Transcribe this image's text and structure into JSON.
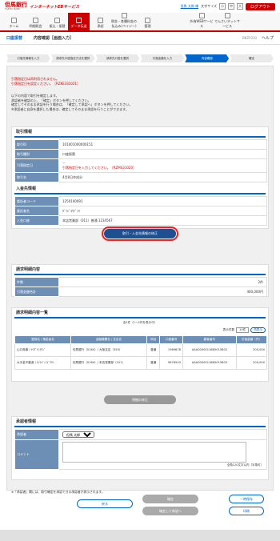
{
  "header": {
    "logo": "但馬銀行",
    "logo_sub": "TAJIMA BANK",
    "service": "インターネットEBサービス",
    "user_line": "但馬 太郎 様",
    "font_label": "文字サイズ",
    "font_small": "小",
    "font_medium": "中",
    "font_large": "大",
    "logout": "ログアウト"
  },
  "nav": [
    {
      "label": "ホーム"
    },
    {
      "label": "明細照会"
    },
    {
      "label": "振込・振替"
    },
    {
      "label": "データ伝送"
    },
    {
      "label": "承認"
    },
    {
      "label": "税金・各種料金の払込み(ペイジー)"
    },
    {
      "label": "管理"
    },
    {
      "label": "外為WEBサービス"
    },
    {
      "label": "でんさいネットサービス"
    }
  ],
  "subheader": {
    "category": "口座振替",
    "title": "内容確認［画面入力］",
    "code": "BKZF010",
    "help": "ヘルプ"
  },
  "steps": [
    "引落先情報を入力",
    "請求先口座指定方法を選択",
    "請求先口座を選択",
    "引落金額を入力",
    "内容確認",
    "確定"
  ],
  "errors": [
    "引落指定日は再利用されません。",
    "引落指定日を設定ください。［RZKE331021］"
  ],
  "intro": [
    "以下の内容で取引を確定します。",
    "承認者を確認の上、「確定」ボタンを押してください。",
    "確定してそのまま承認を行う場合は、「確定して承認へ」ボタンを押してください。",
    "※承認者に自身を選択した場合は、確定してそのまま承認を行うことができます。"
  ],
  "torihiki": {
    "section": "取引情報",
    "rows": [
      {
        "label": "取引ID",
        "value": "101001000000151"
      },
      {
        "label": "取引種別",
        "value": "口座振替"
      },
      {
        "label": "引落指定日",
        "value": "－",
        "error": "引落指定日を入力してください。［RZMS31020］"
      },
      {
        "label": "取引名",
        "value": "4月8日作成分"
      }
    ]
  },
  "nyukin": {
    "section": "入金先情報",
    "rows": [
      {
        "label": "委託者コード",
        "value": "1250100091"
      },
      {
        "label": "委託者名",
        "value": "ﾀﾞｲｼﾞﾖｳﾃﾞﾝｷ"
      },
      {
        "label": "入金口座",
        "value": "本店営業部（011）普通 1234567"
      }
    ],
    "button": "取引・入金先情報の修正"
  },
  "seikyu": {
    "section": "請求明細内容",
    "rows": [
      {
        "label": "件数",
        "value": "2件"
      },
      {
        "label": "引落金額合計",
        "value": "400,000円"
      }
    ]
  },
  "list": {
    "section": "請求明細内容一覧",
    "count_text": "全2件（1～2件を表示中）",
    "per_label": "表示件数",
    "per_value": "10件",
    "per_button": "再表示",
    "headers": [
      "登録名 / 預金者名",
      "金融機関名 / 支店名",
      "科目",
      "口座番号",
      "顧客番号",
      "引落金額（円）"
    ],
    "rows": [
      {
        "name": "山口商事 / ﾔﾏｸﾞﾁｼﾖｳｼﾞ",
        "bank": "但馬銀行（0164）/ 大阪支店（350）",
        "type": "普通",
        "account": "1969878",
        "customer": "AAA00000118B5015802",
        "amount": "200,000"
      },
      {
        "name": "大手金不動産 / ﾀｲﾃｷﾞﾝﾌﾄﾞｳｻﾝ",
        "bank": "但馬銀行（0164）/ 本店営業部（101）",
        "type": "普通",
        "account": "9876543",
        "customer": "AAA00000118B5015803",
        "amount": "200,000"
      }
    ],
    "edit_button": "明細の修正"
  },
  "approver": {
    "section": "承認者情報",
    "approver_label": "承認者",
    "approver_value": "但馬 太郎",
    "comment_label": "コメント",
    "comment_note": "全角120文字以内［半角可］"
  },
  "note": "※「承認者」欄には、取引確定を承認できる承認者が表示されます。",
  "buttons": {
    "back": "戻る",
    "confirm": "確定",
    "confirm_approve": "確定して承認へ",
    "save": "一時保存",
    "print": "印刷"
  }
}
